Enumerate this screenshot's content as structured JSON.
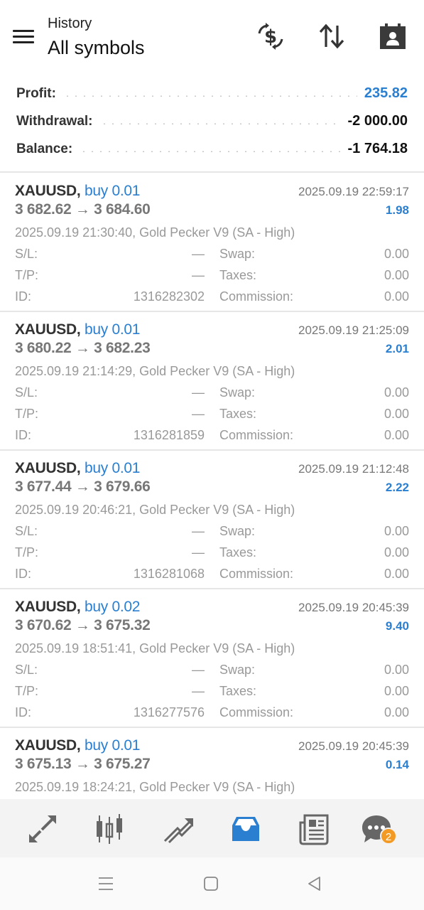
{
  "header": {
    "subtitle": "History",
    "title": "All symbols"
  },
  "summary": [
    {
      "label": "Profit:",
      "value": "235.82",
      "highlight": true
    },
    {
      "label": "Withdrawal:",
      "value": "-2 000.00",
      "highlight": false
    },
    {
      "label": "Balance:",
      "value": "-1 764.18",
      "highlight": false
    }
  ],
  "deals": [
    {
      "symbol": "XAUUSD,",
      "side": "buy 0.01",
      "close_time": "2025.09.19 22:59:17",
      "prices": "3 682.62 → 3 684.60",
      "profit": "1.98",
      "open_info": "2025.09.19 21:30:40, Gold Pecker V9 (SA - High)",
      "sl_label": "S/L:",
      "sl": "—",
      "swap_label": "Swap:",
      "swap": "0.00",
      "tp_label": "T/P:",
      "tp": "—",
      "taxes_label": "Taxes:",
      "taxes": "0.00",
      "id_label": "ID:",
      "id": "1316282302",
      "commission_label": "Commission:",
      "commission": "0.00"
    },
    {
      "symbol": "XAUUSD,",
      "side": "buy 0.01",
      "close_time": "2025.09.19 21:25:09",
      "prices": "3 680.22 → 3 682.23",
      "profit": "2.01",
      "open_info": "2025.09.19 21:14:29, Gold Pecker V9 (SA - High)",
      "sl_label": "S/L:",
      "sl": "—",
      "swap_label": "Swap:",
      "swap": "0.00",
      "tp_label": "T/P:",
      "tp": "—",
      "taxes_label": "Taxes:",
      "taxes": "0.00",
      "id_label": "ID:",
      "id": "1316281859",
      "commission_label": "Commission:",
      "commission": "0.00"
    },
    {
      "symbol": "XAUUSD,",
      "side": "buy 0.01",
      "close_time": "2025.09.19 21:12:48",
      "prices": "3 677.44 → 3 679.66",
      "profit": "2.22",
      "open_info": "2025.09.19 20:46:21, Gold Pecker V9 (SA - High)",
      "sl_label": "S/L:",
      "sl": "—",
      "swap_label": "Swap:",
      "swap": "0.00",
      "tp_label": "T/P:",
      "tp": "—",
      "taxes_label": "Taxes:",
      "taxes": "0.00",
      "id_label": "ID:",
      "id": "1316281068",
      "commission_label": "Commission:",
      "commission": "0.00"
    },
    {
      "symbol": "XAUUSD,",
      "side": "buy 0.02",
      "close_time": "2025.09.19 20:45:39",
      "prices": "3 670.62 → 3 675.32",
      "profit": "9.40",
      "open_info": "2025.09.19 18:51:41, Gold Pecker V9 (SA - High)",
      "sl_label": "S/L:",
      "sl": "—",
      "swap_label": "Swap:",
      "swap": "0.00",
      "tp_label": "T/P:",
      "tp": "—",
      "taxes_label": "Taxes:",
      "taxes": "0.00",
      "id_label": "ID:",
      "id": "1316277576",
      "commission_label": "Commission:",
      "commission": "0.00"
    },
    {
      "symbol": "XAUUSD,",
      "side": "buy 0.01",
      "close_time": "2025.09.19 20:45:39",
      "prices": "3 675.13 → 3 675.27",
      "profit": "0.14",
      "open_info": "2025.09.19 18:24:21, Gold Pecker V9 (SA - High)"
    }
  ],
  "bottom_nav": {
    "items": [
      "quotes-icon",
      "chart-icon",
      "trade-icon",
      "history-icon",
      "news-icon",
      "chat-icon"
    ],
    "active": "history-icon",
    "chat_badge": "2"
  },
  "colors": {
    "accent": "#2a7fd0",
    "badge": "#f39a24"
  }
}
